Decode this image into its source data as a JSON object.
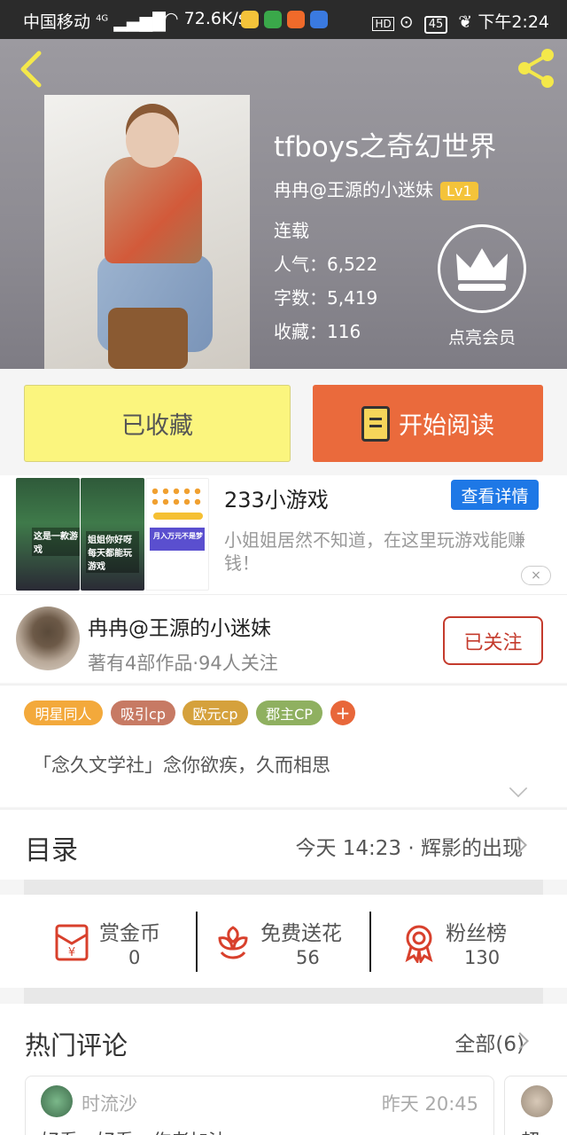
{
  "status_bar": {
    "carrier": "中国移动",
    "network": "4G",
    "speed": "72.6K/s",
    "hd": "HD",
    "battery": "45",
    "time": "下午2:24",
    "app_icon_colors": [
      "#f4c33a",
      "#3aa84a",
      "#f06a2a",
      "#3a7ae0"
    ]
  },
  "header": {
    "back_icon": "chevron-left-icon",
    "share_icon": "share-icon",
    "title": "tfboys之奇幻世界",
    "author": "冉冉@王源的小迷妹",
    "level": "Lv1",
    "status": "连载",
    "popularity": "人气：6,522",
    "word_count": "字数：5,419",
    "favorites": "收藏：116",
    "vip_label": "点亮会员"
  },
  "actions": {
    "favorited_label": "已收藏",
    "read_label": "开始阅读"
  },
  "ad": {
    "img1_text": "这是一款游戏",
    "img2_text": "姐姐你好呀 每天都能玩游戏",
    "img3_text": "月入万元不是梦",
    "title": "233小游戏",
    "detail_button": "查看详情",
    "description": "小姐姐居然不知道，在这里玩游戏能赚钱！",
    "close": "×"
  },
  "author_section": {
    "name": "冉冉@王源的小迷妹",
    "meta": "著有4部作品·94人关注",
    "follow_label": "已关注"
  },
  "tags": [
    {
      "label": "明星同人",
      "color": "#f3a93b"
    },
    {
      "label": "吸引cp",
      "color": "#c77a64"
    },
    {
      "label": "欧元cp",
      "color": "#d5a13c"
    },
    {
      "label": "郡主CP",
      "color": "#8fb060"
    }
  ],
  "tag_add": "+",
  "intro": "「念久文学社」念你欲疾，久而相思",
  "toc": {
    "title": "目录",
    "latest": "今天 14:23 · 辉影的出现"
  },
  "gifts": [
    {
      "label": "赏金币",
      "value": "0",
      "icon": "red-envelope-icon"
    },
    {
      "label": "免费送花",
      "value": "56",
      "icon": "flower-icon"
    },
    {
      "label": "粉丝榜",
      "value": "130",
      "icon": "medal-icon"
    }
  ],
  "comments": {
    "title": "热门评论",
    "all": "全部(6)",
    "first": {
      "name": "时流沙",
      "time": "昨天 20:45",
      "text": "好看，好看，作者加油"
    },
    "second": {
      "text": "超"
    }
  },
  "colors": {
    "accent_orange": "#ea6a3c",
    "favorited_yellow": "#fbf57e",
    "follow_red": "#c43b2d",
    "detail_blue": "#1e78e6"
  }
}
